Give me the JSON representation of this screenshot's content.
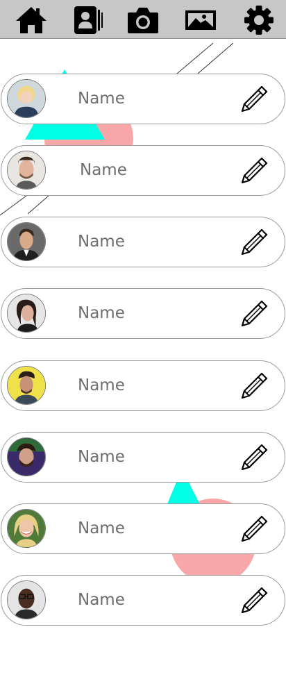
{
  "toolbar": {
    "items": [
      {
        "icon": "home-icon"
      },
      {
        "icon": "contacts-icon"
      },
      {
        "icon": "camera-icon"
      },
      {
        "icon": "gallery-icon"
      },
      {
        "icon": "settings-icon"
      }
    ]
  },
  "colors": {
    "toolbar_bg": "#c7c7c7",
    "decor_cyan": "#00ffe5",
    "decor_pink": "#f9a7a9",
    "card_border": "#9a9a9a",
    "name_text": "#6d6d6d"
  },
  "contacts": [
    {
      "name": "Name",
      "avatar": "avatar-blonde-short-hair",
      "edit_icon": "pencil-icon"
    },
    {
      "name": "Name",
      "avatar": "avatar-man-stubble",
      "edit_icon": "pencil-icon"
    },
    {
      "name": "Name",
      "avatar": "avatar-man-suit",
      "edit_icon": "pencil-icon"
    },
    {
      "name": "Name",
      "avatar": "avatar-woman-dark-hair",
      "edit_icon": "pencil-icon"
    },
    {
      "name": "Name",
      "avatar": "avatar-man-yellow-bg",
      "edit_icon": "pencil-icon"
    },
    {
      "name": "Name",
      "avatar": "avatar-man-beard-hat",
      "edit_icon": "pencil-icon"
    },
    {
      "name": "Name",
      "avatar": "avatar-woman-blonde-long-hair",
      "edit_icon": "pencil-icon"
    },
    {
      "name": "Name",
      "avatar": "avatar-man-glasses",
      "edit_icon": "pencil-icon"
    }
  ]
}
